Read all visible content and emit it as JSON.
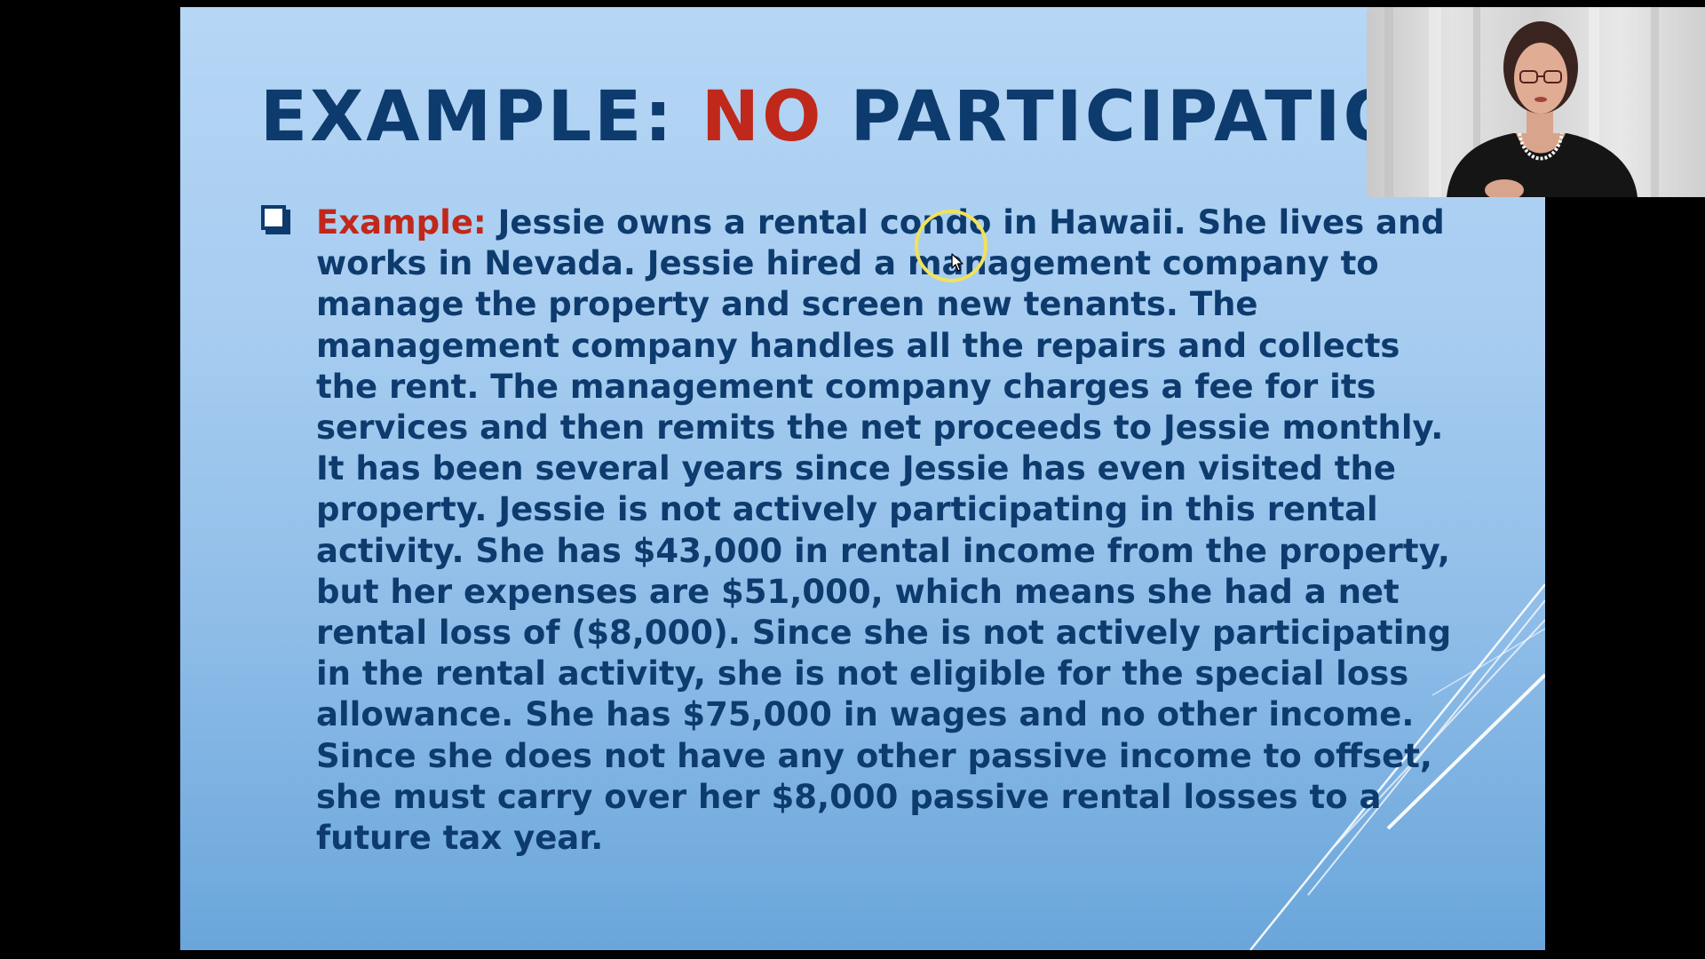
{
  "slide": {
    "title_prefix": "EXAMPLE: ",
    "title_accent": "NO",
    "title_suffix": " PARTICIPATION",
    "bullet_label": "Example:",
    "bullet_text": " Jessie owns a rental condo in Hawaii. She lives and works in Nevada. Jessie hired a management company to manage the property and screen new tenants. The management company handles all the repairs and collects the rent. The management company charges a fee for its services and then remits the net proceeds to Jessie monthly. It has been several years since Jessie has even visited the property. Jessie is not actively participating in this rental activity. She has $43,000 in rental income from the property, but her expenses are $51,000, which means she had a net rental loss of ($8,000). Since she is not actively participating in the rental activity, she is not eligible for the special loss allowance. She has $75,000 in wages and no other income. Since she does not have any other passive income to offset, she must carry over her $8,000 passive rental losses to a future tax year."
  },
  "colors": {
    "title_blue": "#0d3b6e",
    "accent_red": "#c0281b",
    "cursor_highlight": "#f2e25a"
  },
  "icons": {
    "bullet": "checkbox-square-icon",
    "cursor": "mouse-pointer-icon"
  }
}
